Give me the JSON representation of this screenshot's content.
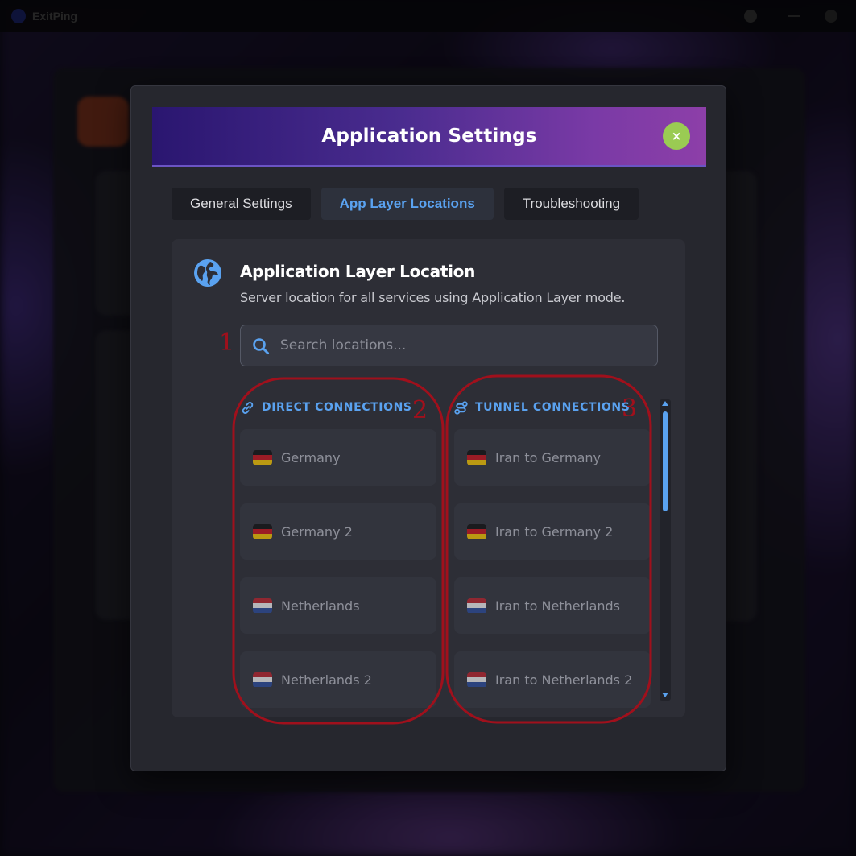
{
  "background_app": {
    "name": "ExitPing"
  },
  "modal": {
    "title": "Application Settings",
    "close_label": "×",
    "tabs": [
      {
        "label": "General Settings",
        "active": false
      },
      {
        "label": "App Layer Locations",
        "active": true
      },
      {
        "label": "Troubleshooting",
        "active": false
      }
    ]
  },
  "card": {
    "title": "Application Layer Location",
    "subtitle": "Server location for all services using Application Layer mode.",
    "icon": "globe-icon",
    "search": {
      "placeholder": "Search locations...",
      "value": "",
      "icon": "search-icon"
    },
    "direct": {
      "heading": "DIRECT CONNECTIONS",
      "icon": "link-icon",
      "items": [
        {
          "label": "Germany",
          "flag": "de"
        },
        {
          "label": "Germany 2",
          "flag": "de"
        },
        {
          "label": "Netherlands",
          "flag": "nl"
        },
        {
          "label": "Netherlands 2",
          "flag": "nl"
        }
      ]
    },
    "tunnel": {
      "heading": "TUNNEL CONNECTIONS",
      "icon": "route-icon",
      "items": [
        {
          "label": "Iran to Germany",
          "flag": "de"
        },
        {
          "label": "Iran to Germany 2",
          "flag": "de"
        },
        {
          "label": "Iran to Netherlands",
          "flag": "nl"
        },
        {
          "label": "Iran to Netherlands 2",
          "flag": "nl"
        }
      ]
    }
  },
  "annotations": {
    "labels": [
      "1",
      "2",
      "3"
    ],
    "color": "#a0101c"
  },
  "colors": {
    "accent": "#5aa2f0",
    "close_button": "#9acb53",
    "header_gradient_start": "#2a1670",
    "header_gradient_end": "#8d3fa8",
    "modal_bg": "#26272e"
  }
}
